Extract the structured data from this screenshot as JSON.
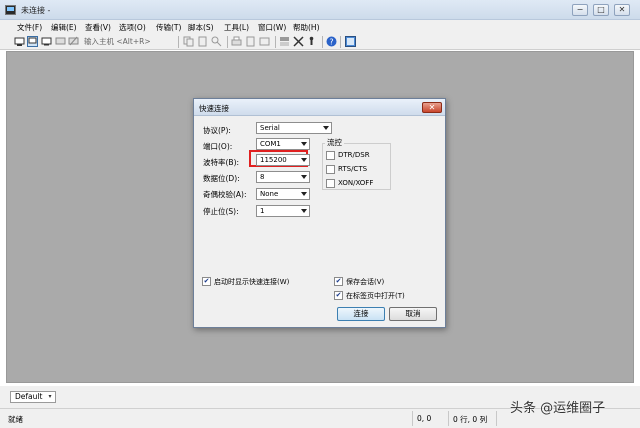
{
  "window": {
    "title": "未连接 -",
    "min": "−",
    "max": "□",
    "close": "✕"
  },
  "menu": [
    "文件(F)",
    "编辑(E)",
    "查看(V)",
    "选项(O)",
    "传输(T)",
    "脚本(S)",
    "工具(L)",
    "窗口(W)",
    "帮助(H)"
  ],
  "toolbar": {
    "host_placeholder": "输入主机 <Alt+R>"
  },
  "dialog": {
    "title": "快速连接",
    "close": "✕",
    "protocol": {
      "label": "协议(P):",
      "value": "Serial"
    },
    "port": {
      "label": "端口(O):",
      "value": "COM1"
    },
    "baud": {
      "label": "波特率(B):",
      "value": "115200"
    },
    "databits": {
      "label": "数据位(D):",
      "value": "8"
    },
    "parity": {
      "label": "奇偶校验(A):",
      "value": "None"
    },
    "stopbits": {
      "label": "停止位(S):",
      "value": "1"
    },
    "flow": {
      "title": "流控",
      "dtr": "DTR/DSR",
      "rts": "RTS/CTS",
      "xon": "XON/XOFF"
    },
    "show_on_startup": {
      "label": "启动时显示快速连接(W)",
      "checked": "✔"
    },
    "save_session": {
      "label": "保存会话(V)",
      "checked": "✔"
    },
    "open_in_tab": {
      "label": "在标签页中打开(T)",
      "checked": "✔"
    },
    "connect": "连接",
    "cancel": "取消"
  },
  "session": {
    "value": "Default",
    "arrow": "▾"
  },
  "status": {
    "ready": "就绪",
    "pos": "0, 0",
    "rowcol": "0 行, 0 列"
  },
  "watermark": "头条 @运维圈子"
}
